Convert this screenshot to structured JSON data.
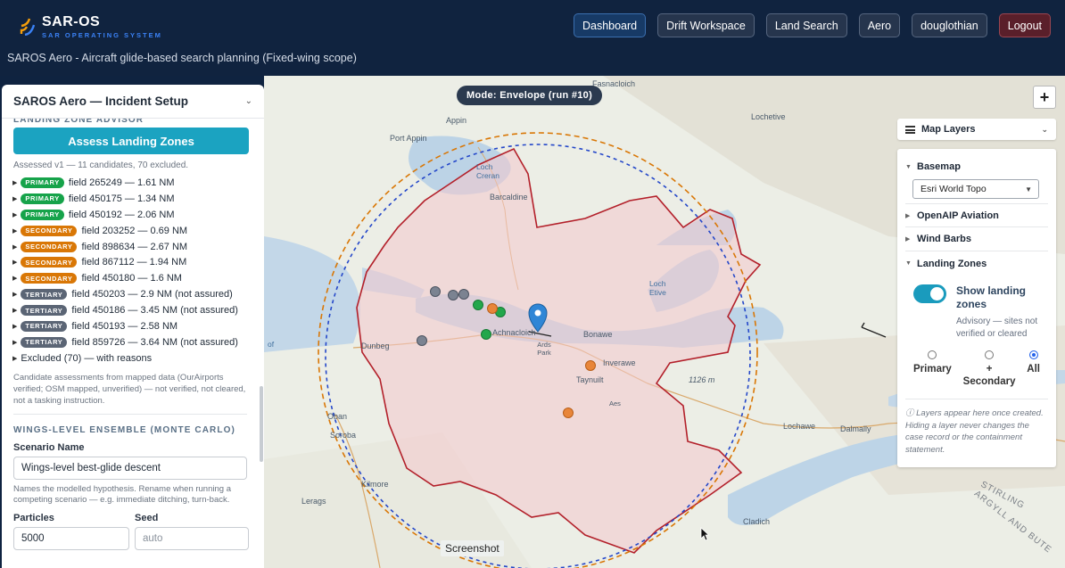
{
  "app": {
    "title": "SAR-OS",
    "tagline": "SAR OPERATING SYSTEM",
    "subtitle": "SAROS Aero - Aircraft glide-based search planning (Fixed-wing scope)"
  },
  "nav": {
    "dashboard": "Dashboard",
    "drift": "Drift Workspace",
    "land": "Land Search",
    "aero": "Aero",
    "user": "douglothian",
    "logout": "Logout"
  },
  "map": {
    "mode_label": "Mode: Envelope (run #10)",
    "zoom_in": "+",
    "screenshot_label": "Screenshot",
    "places": {
      "appin": "Appin",
      "port_appin": "Port Appin",
      "fasnacloich": "Fasnacloich",
      "lochetive": "Lochetive",
      "loch_creran": "Loch Creran",
      "barcaldine": "Barcaldine",
      "loch_etive": "Loch Etive",
      "achnacloich": "Achnacloich",
      "bonawe": "Bonawe",
      "ardspark": "Ards Park",
      "inverawe": "Inverawe",
      "taynuilt": "Taynuilt",
      "height": "1126 m",
      "dunbeg": "Dunbeg",
      "of": "of",
      "oban": "Oban",
      "soroba": "Soroba",
      "kilmore": "Kilmore",
      "lerags": "Lerags",
      "cladich": "Cladich",
      "lochawe": "Lochawe",
      "dalmally": "Dalmally",
      "stirling": "STIRLING",
      "argyll": "ARGYLL AND BUTE",
      "aes": "Aes"
    }
  },
  "layers": {
    "title": "Map Layers",
    "basemap": "Basemap",
    "basemap_value": "Esri World Topo",
    "openaip": "OpenAIP Aviation",
    "wind": "Wind Barbs",
    "landing_zones": "Landing Zones",
    "show_label": "Show landing zones",
    "show_note": "Advisory — sites not verified or cleared",
    "radio_primary": "Primary",
    "radio_secondary": "+ Secondary",
    "radio_all": "All",
    "info": "ⓘ Layers appear here once created. Hiding a layer never changes the case record or the containment statement."
  },
  "panel": {
    "title": "SAROS Aero — Incident Setup",
    "section_lz": "LANDING ZONE ADVISOR",
    "assess_button": "Assess Landing Zones",
    "assess_note": "Assessed v1 — 11 candidates, 70 excluded.",
    "items": [
      {
        "badge": "PRIMARY",
        "tier": "primary",
        "text": "field 265249 — 1.61 NM"
      },
      {
        "badge": "PRIMARY",
        "tier": "primary",
        "text": "field 450175 — 1.34 NM"
      },
      {
        "badge": "PRIMARY",
        "tier": "primary",
        "text": "field 450192 — 2.06 NM"
      },
      {
        "badge": "SECONDARY",
        "tier": "secondary",
        "text": "field 203252 — 0.69 NM"
      },
      {
        "badge": "SECONDARY",
        "tier": "secondary",
        "text": "field 898634 — 2.67 NM"
      },
      {
        "badge": "SECONDARY",
        "tier": "secondary",
        "text": "field 867112 — 1.94 NM"
      },
      {
        "badge": "SECONDARY",
        "tier": "secondary",
        "text": "field 450180 — 1.6 NM"
      },
      {
        "badge": "TERTIARY",
        "tier": "tertiary",
        "text": "field 450203 — 2.9 NM (not assured)"
      },
      {
        "badge": "TERTIARY",
        "tier": "tertiary",
        "text": "field 450186 — 3.45 NM (not assured)"
      },
      {
        "badge": "TERTIARY",
        "tier": "tertiary",
        "text": "field 450193 — 2.58 NM"
      },
      {
        "badge": "TERTIARY",
        "tier": "tertiary",
        "text": "field 859726 — 3.64 NM (not assured)"
      }
    ],
    "excluded": "Excluded (70) — with reasons",
    "candidate_note": "Candidate assessments from mapped data (OurAirports verified; OSM mapped, unverified) — not verified, not cleared, not a tasking instruction.",
    "section_wings": "WINGS-LEVEL ENSEMBLE (MONTE CARLO)",
    "scenario_label": "Scenario Name",
    "scenario_value": "Wings-level best-glide descent",
    "scenario_help": "Names the modelled hypothesis. Rename when running a competing scenario — e.g. immediate ditching, turn-back.",
    "particles_label": "Particles",
    "particles_value": "5000",
    "seed_label": "Seed",
    "seed_placeholder": "auto"
  },
  "colors": {
    "header": "#10233f",
    "accent": "#1ba3c1",
    "primary": "#16a34a",
    "secondary": "#d97706",
    "tertiary": "#5b6575",
    "envelope_red": "#b3202a",
    "ring_orange": "#d97706",
    "ring_blue": "#2447c9"
  }
}
